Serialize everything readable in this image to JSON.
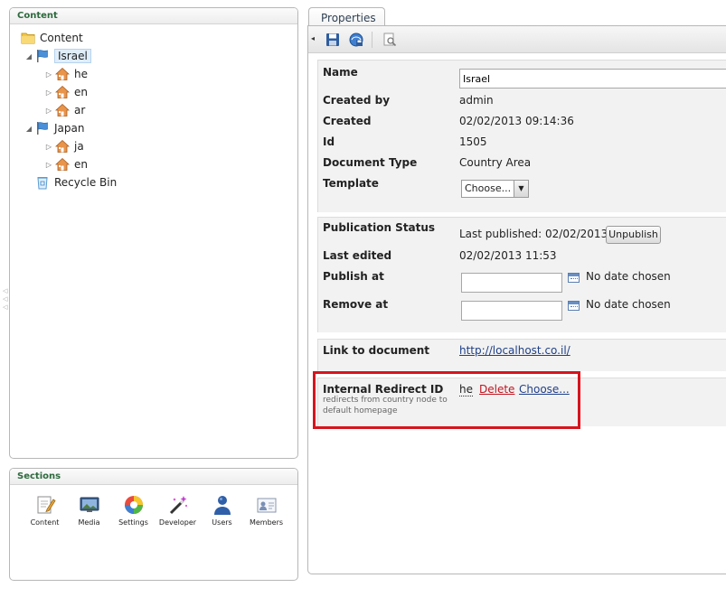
{
  "content_panel": {
    "title": "Content",
    "tree": {
      "root": "Content",
      "nodes": [
        {
          "label": "Israel",
          "expanded": true,
          "selected": true,
          "children": [
            "he",
            "en",
            "ar"
          ]
        },
        {
          "label": "Japan",
          "expanded": true,
          "selected": false,
          "children": [
            "ja",
            "en"
          ]
        }
      ],
      "recycle_bin": "Recycle Bin"
    }
  },
  "sections_panel": {
    "title": "Sections",
    "items": [
      {
        "label": "Content",
        "icon": "pencil-document-icon"
      },
      {
        "label": "Media",
        "icon": "media-monitor-icon"
      },
      {
        "label": "Settings",
        "icon": "color-wheel-icon"
      },
      {
        "label": "Developer",
        "icon": "magic-wand-icon"
      },
      {
        "label": "Users",
        "icon": "user-icon"
      },
      {
        "label": "Members",
        "icon": "member-card-icon"
      }
    ]
  },
  "properties": {
    "tab_label": "Properties",
    "toolbar": {
      "icons": [
        "collapse-arrow-icon",
        "save-icon",
        "save-publish-icon",
        "preview-icon"
      ]
    },
    "general": {
      "name_label": "Name",
      "name_value": "Israel",
      "created_by_label": "Created by",
      "created_by_value": "admin",
      "created_label": "Created",
      "created_value": "02/02/2013 09:14:36",
      "id_label": "Id",
      "id_value": "1505",
      "doctype_label": "Document Type",
      "doctype_value": "Country Area",
      "template_label": "Template",
      "template_value": "Choose..."
    },
    "publication": {
      "status_label": "Publication Status",
      "status_value": "Last published: 02/02/2013",
      "unpublish_label": "Unpublish",
      "last_edited_label": "Last edited",
      "last_edited_value": "02/02/2013 11:53",
      "publish_at_label": "Publish at",
      "publish_at_value": "",
      "publish_at_status": "No date chosen",
      "remove_at_label": "Remove at",
      "remove_at_value": "",
      "remove_at_status": "No date chosen"
    },
    "link": {
      "label": "Link to document",
      "url": "http://localhost.co.il/"
    },
    "redirect": {
      "label": "Internal Redirect ID",
      "help": "redirects from country node to default homepage",
      "value": "he",
      "delete_label": "Delete",
      "choose_label": "Choose..."
    }
  },
  "colors": {
    "panel_header_text": "#2d6a3c",
    "link": "#1f3f87",
    "delete_link": "#c0141f",
    "highlight_border": "#d8141d",
    "group_background": "#f2f2f2"
  }
}
